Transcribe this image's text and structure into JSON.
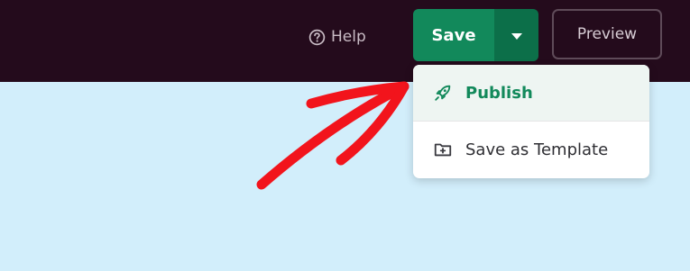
{
  "header": {
    "help": {
      "label": "Help",
      "icon": "help-circle-icon"
    },
    "save": {
      "label": "Save",
      "caret_icon": "caret-down-icon"
    },
    "preview": {
      "label": "Preview"
    }
  },
  "dropdown": {
    "items": [
      {
        "label": "Publish",
        "icon": "rocket-icon",
        "highlighted": true
      },
      {
        "label": "Save as Template",
        "icon": "folder-plus-icon",
        "highlighted": false
      }
    ]
  },
  "annotation": {
    "icon": "red-arrow",
    "color": "#f2141c"
  },
  "colors": {
    "topbar": "#240b1c",
    "canvas": "#d2eefb",
    "save_green": "#12895b",
    "caret_green": "#0c6f49"
  }
}
